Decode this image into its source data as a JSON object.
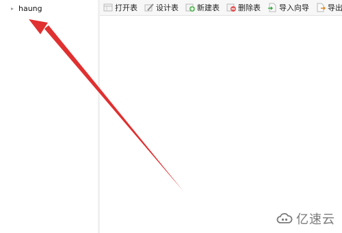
{
  "tree": {
    "db_label": "haung",
    "db_icon": "database-node-icon"
  },
  "toolbar": {
    "buttons": [
      {
        "label": "打开表",
        "icon": "open-table-icon"
      },
      {
        "label": "设计表",
        "icon": "design-table-icon"
      },
      {
        "label": "新建表",
        "icon": "new-table-icon"
      },
      {
        "label": "删除表",
        "icon": "delete-table-icon"
      },
      {
        "label": "导入向导",
        "icon": "import-wizard-icon"
      },
      {
        "label": "导出向导",
        "icon": "export-wizard-icon"
      }
    ]
  },
  "watermark": {
    "text": "亿速云",
    "icon": "cloud-logo-icon"
  },
  "annotation": {
    "color": "#e03030"
  }
}
